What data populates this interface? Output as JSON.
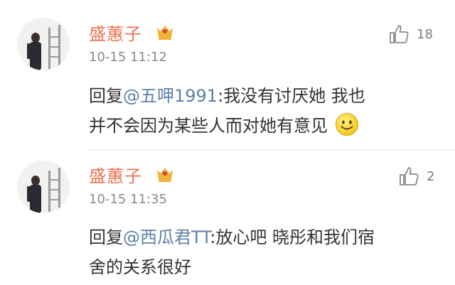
{
  "comments": [
    {
      "username": "盛蕙子",
      "time": "10-15 11:12",
      "likes": "18",
      "reply_prefix": "回复",
      "mention": "@五呷1991",
      "line1_rest": ":我没有讨厌她 我也",
      "line2": "并不会因为某些人而对她有意见",
      "has_emoji": true,
      "emoji_icon": "smile-emoji-icon"
    },
    {
      "username": "盛蕙子",
      "time": "10-15 11:35",
      "likes": "2",
      "reply_prefix": "回复",
      "mention": "@西瓜君TT",
      "line1_rest": ":放心吧 晓彤和我们宿",
      "line2": "舍的关系很好",
      "has_emoji": false
    }
  ],
  "colors": {
    "username": "#eb7350",
    "mention": "#5c7fa8",
    "body_text": "#333333",
    "timestamp": "#8a8a8a",
    "badge_gold": "#f0b43a",
    "badge_red": "#e0452e"
  }
}
